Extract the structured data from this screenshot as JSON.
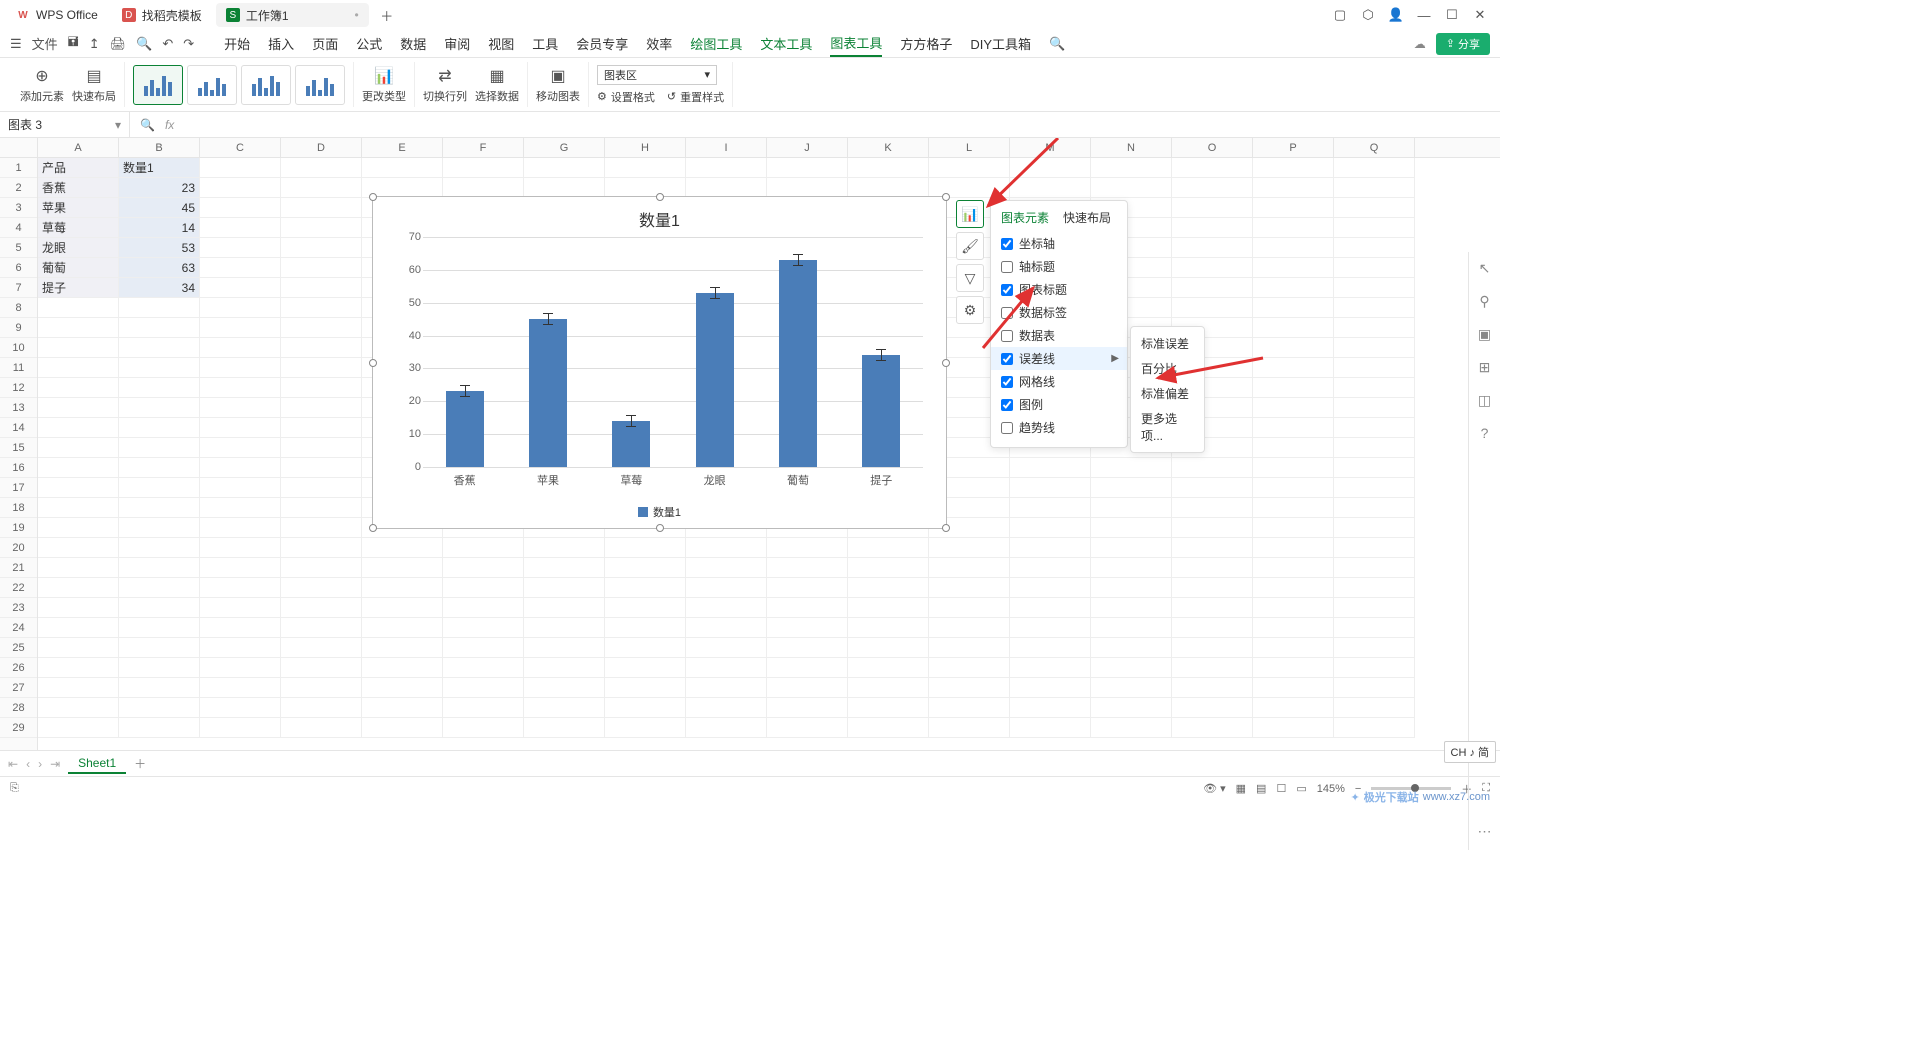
{
  "titlebar": {
    "tabs": [
      {
        "icon": "W",
        "label": "WPS Office"
      },
      {
        "icon": "D",
        "label": "找稻壳模板"
      },
      {
        "icon": "S",
        "label": "工作簿1"
      }
    ]
  },
  "menubar": {
    "file": "文件",
    "tabs": [
      "开始",
      "插入",
      "页面",
      "公式",
      "数据",
      "审阅",
      "视图",
      "工具",
      "会员专享",
      "效率"
    ],
    "green_tabs": [
      "绘图工具",
      "文本工具",
      "图表工具",
      "方方格子",
      "DIY工具箱"
    ],
    "active_tab": "图表工具",
    "share": "分享"
  },
  "ribbon": {
    "add_element": "添加元素",
    "quick_layout": "快速布局",
    "change_type": "更改类型",
    "switch_rc": "切换行列",
    "select_data": "选择数据",
    "move_chart": "移动图表",
    "chart_area": "图表区",
    "set_format": "设置格式",
    "reset_style": "重置样式"
  },
  "namebox": "图表 3",
  "columns": [
    "A",
    "B",
    "C",
    "D",
    "E",
    "F",
    "G",
    "H",
    "I",
    "J",
    "K",
    "L",
    "M",
    "N",
    "O",
    "P",
    "Q"
  ],
  "data_rows": [
    {
      "A": "产品",
      "B": "数量1"
    },
    {
      "A": "香蕉",
      "B": "23"
    },
    {
      "A": "苹果",
      "B": "45"
    },
    {
      "A": "草莓",
      "B": "14"
    },
    {
      "A": "龙眼",
      "B": "53"
    },
    {
      "A": "葡萄",
      "B": "63"
    },
    {
      "A": "提子",
      "B": "34"
    }
  ],
  "chart_data": {
    "type": "bar",
    "title": "数量1",
    "categories": [
      "香蕉",
      "苹果",
      "草莓",
      "龙眼",
      "葡萄",
      "提子"
    ],
    "values": [
      23,
      45,
      14,
      53,
      63,
      34
    ],
    "ylim": [
      0,
      70
    ],
    "yticks": [
      0,
      10,
      20,
      30,
      40,
      50,
      60,
      70
    ],
    "legend": "数量1",
    "xlabel": "",
    "ylabel": ""
  },
  "popup": {
    "tab_elements": "图表元素",
    "tab_layout": "快速布局",
    "items": [
      {
        "label": "坐标轴",
        "checked": true
      },
      {
        "label": "轴标题",
        "checked": false
      },
      {
        "label": "图表标题",
        "checked": true
      },
      {
        "label": "数据标签",
        "checked": false
      },
      {
        "label": "数据表",
        "checked": false
      },
      {
        "label": "误差线",
        "checked": true,
        "submenu": true,
        "highlight": true
      },
      {
        "label": "网格线",
        "checked": true
      },
      {
        "label": "图例",
        "checked": true
      },
      {
        "label": "趋势线",
        "checked": false
      }
    ],
    "submenu": [
      "标准误差",
      "百分比",
      "标准偏差",
      "更多选项..."
    ]
  },
  "sheet_tab": "Sheet1",
  "zoom": "145%",
  "ime": "CH ♪ 简",
  "watermark": {
    "brand": "极光下载站",
    "url": "www.xz7.com"
  }
}
